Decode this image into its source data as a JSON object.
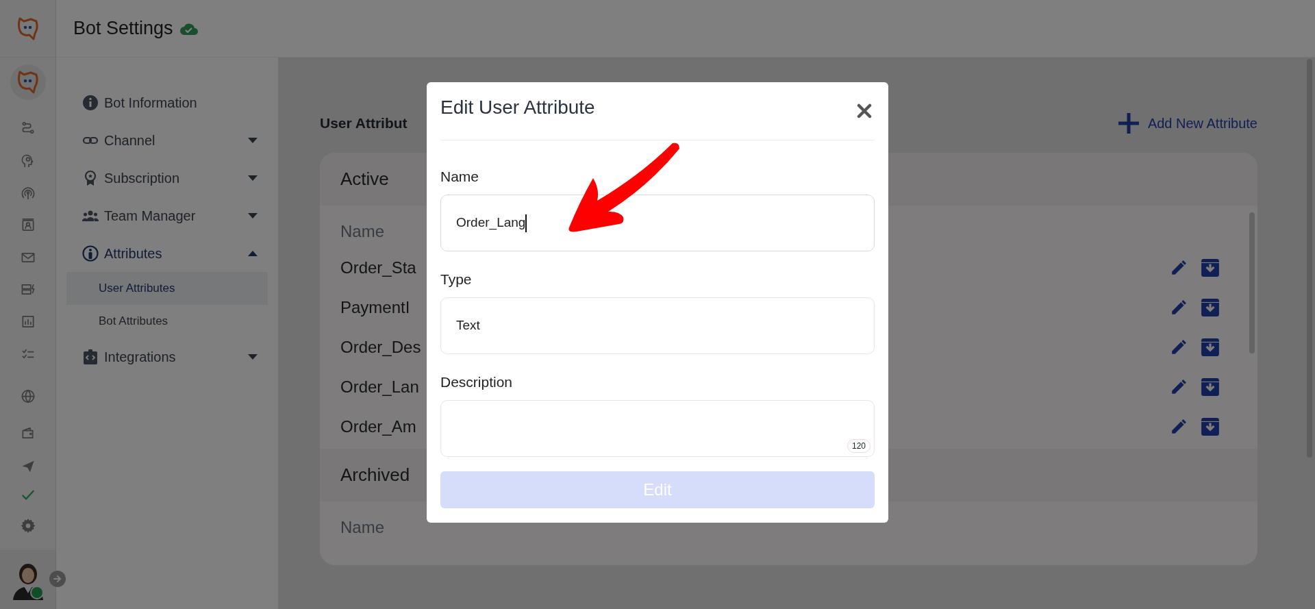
{
  "header": {
    "title": "Bot Settings",
    "saved": true
  },
  "settings_menu": [
    {
      "label": "Bot Information",
      "kind": "link",
      "expanded": false
    },
    {
      "label": "Channel",
      "kind": "group",
      "expanded": false
    },
    {
      "label": "Subscription",
      "kind": "group",
      "expanded": false
    },
    {
      "label": "Team Manager",
      "kind": "group",
      "expanded": false
    },
    {
      "label": "Attributes",
      "kind": "group",
      "expanded": true,
      "children": [
        {
          "label": "User Attributes",
          "selected": true
        },
        {
          "label": "Bot Attributes",
          "selected": false
        }
      ]
    },
    {
      "label": "Integrations",
      "kind": "group",
      "expanded": false
    }
  ],
  "content": {
    "title": "User Attribut",
    "add_button": "Add New Attribute",
    "sections": [
      {
        "title": "Active",
        "column": "Name",
        "rows": [
          "Order_Sta",
          "PaymentI",
          "Order_Des",
          "Order_Lan",
          "Order_Am"
        ]
      },
      {
        "title": "Archived",
        "column": "Name"
      }
    ]
  },
  "modal": {
    "title": "Edit User Attribute",
    "fields": [
      {
        "label": "Name",
        "value": "Order_Lang",
        "focused": true
      },
      {
        "label": "Type",
        "value": "Text",
        "focused": false
      },
      {
        "label": "Description",
        "counter": "120",
        "focused": false
      }
    ],
    "submit": {
      "label": "Edit",
      "disabled": true
    }
  }
}
